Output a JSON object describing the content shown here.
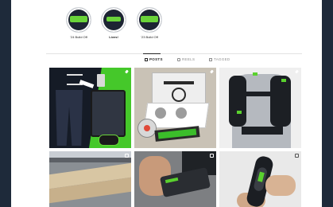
{
  "highlights": [
    {
      "label": "'24 Build Off",
      "bold": false,
      "icon": "festool-logo-icon"
    },
    {
      "label": "Lives!",
      "bold": true,
      "icon": "live-icon"
    },
    {
      "label": "'23 Build Off",
      "bold": false,
      "icon": "festool-logo-icon"
    }
  ],
  "tabs": [
    {
      "label": "POSTS",
      "active": true,
      "icon": "grid-icon"
    },
    {
      "label": "REELS",
      "active": false,
      "icon": "play-icon"
    },
    {
      "label": "TAGGED",
      "active": false,
      "icon": "tag-icon"
    }
  ],
  "posts": [
    {
      "alt": "product-collage",
      "badge": "pin-icon"
    },
    {
      "alt": "saw-blade-box",
      "badge": "pin-icon"
    },
    {
      "alt": "backpack",
      "badge": "pin-icon"
    },
    {
      "alt": "tool-on-wood",
      "badge": "carousel-icon"
    },
    {
      "alt": "hand-with-tool",
      "badge": "carousel-icon"
    },
    {
      "alt": "hand-with-device",
      "badge": "carousel-icon"
    }
  ],
  "colors": {
    "frame": "#1e2a3a",
    "accent_green": "#5ad12e",
    "background": "#ffffff"
  }
}
